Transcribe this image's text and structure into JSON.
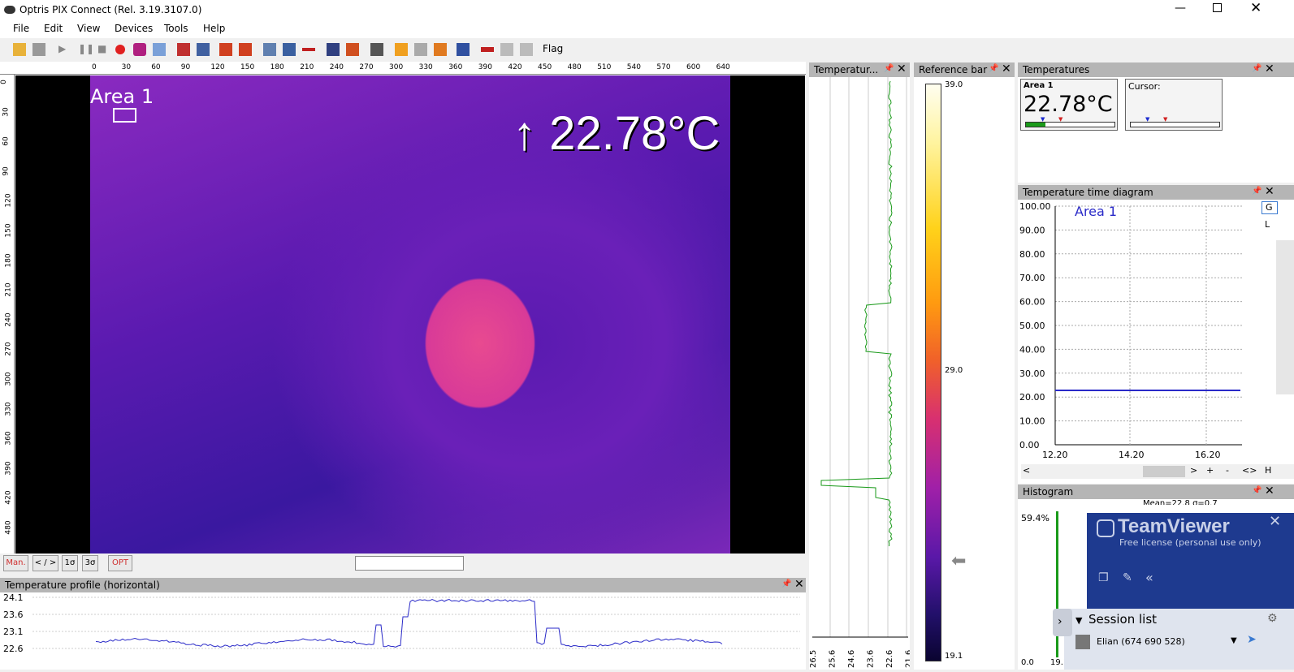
{
  "window": {
    "title": "Optris PIX Connect (Rel. 3.19.3107.0)"
  },
  "menu": [
    "File",
    "Edit",
    "View",
    "Devices",
    "Tools",
    "Help"
  ],
  "toolbar": {
    "flag_label": "Flag"
  },
  "thermal_view": {
    "area_label": "Area 1",
    "max_temp": "↑ 22.78°C",
    "ruler_x": [
      "0",
      "30",
      "60",
      "90",
      "120",
      "150",
      "180",
      "210",
      "240",
      "270",
      "300",
      "330",
      "360",
      "390",
      "420",
      "450",
      "480",
      "510",
      "540",
      "570",
      "600",
      "640"
    ],
    "ruler_y": [
      "0",
      "30",
      "60",
      "90",
      "120",
      "150",
      "180",
      "210",
      "240",
      "270",
      "300",
      "330",
      "360",
      "390",
      "420",
      "480"
    ]
  },
  "view_buttons": [
    "Man.",
    "< / >",
    "1σ",
    "3σ",
    "OPT"
  ],
  "panels": {
    "temp_vertical": "Temperatur...",
    "reference_bar": "Reference bar",
    "temperatures": "Temperatures",
    "time_diagram": "Temperature time diagram",
    "histogram": "Histogram",
    "profile_horizontal": "Temperature profile (horizontal)"
  },
  "vertical_profile_ticks": [
    "26.5",
    "25.6",
    "24.6",
    "23.6",
    "22.6",
    "21.6"
  ],
  "reference_bar_ticks": [
    "39.0",
    "29.0",
    "19.1"
  ],
  "temperatures_panel": {
    "area_title": "Area 1",
    "area_value": "22.78°C",
    "cursor_title": "Cursor:"
  },
  "time_diagram": {
    "legend": "Area 1",
    "y_ticks": [
      "100.00",
      "90.00",
      "80.00",
      "70.00",
      "60.00",
      "50.00",
      "40.00",
      "30.00",
      "20.00",
      "10.00",
      "0.00"
    ],
    "x_ticks": [
      "12.20",
      "14.20",
      "16.20"
    ],
    "side_buttons": [
      "G",
      "L"
    ],
    "scroll_labels": [
      "<",
      ">",
      "+",
      "-",
      "<>",
      "H"
    ]
  },
  "histogram": {
    "y_top": "59.4%",
    "y_bottom": "0.0",
    "x_start": "19.1°",
    "stats_partial": "Mean=22.8 σ=0.7"
  },
  "profile_horizontal": {
    "y_ticks": [
      "24.1",
      "23.6",
      "23.1",
      "22.6"
    ]
  },
  "teamviewer": {
    "title": "TeamViewer",
    "subtitle": "Free license (personal use only)",
    "session_title": "Session list",
    "session_user": "Elian (674 690 528)"
  },
  "colors": {
    "accent_blue": "#2a2ac8",
    "profile_green": "#1a9a1a",
    "iron_dark": "#3a1a9a",
    "iron_mid": "#9a2ab8",
    "iron_hot": "#e8408a"
  }
}
